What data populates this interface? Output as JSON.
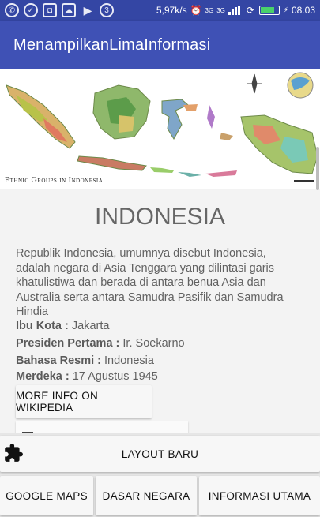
{
  "status_bar": {
    "speed": "5,97k/s",
    "net1": "3G",
    "net2": "3G",
    "time": "08.03",
    "notification_number": "3"
  },
  "app_bar": {
    "title": "MenampilkanLimaInformasi"
  },
  "map": {
    "caption": "Ethnic Groups in Indonesia"
  },
  "content": {
    "country_title": "INDONESIA",
    "description": "Republik Indonesia, umumnya disebut Indonesia, adalah negara di Asia Tenggara yang dilintasi garis khatulistiwa dan berada di antara benua Asia dan Australia serta antara Samudra Pasifik dan Samudra Hindia",
    "facts": [
      {
        "label": "Ibu Kota :",
        "value": "Jakarta"
      },
      {
        "label": "Presiden Pertama :",
        "value": "Ir. Soekarno"
      },
      {
        "label": "Bahasa Resmi :",
        "value": "Indonesia"
      },
      {
        "label": "Merdeka :",
        "value": "17 Agustus 1945"
      }
    ],
    "wiki_button": "MORE INFO ON WIKIPEDIA"
  },
  "bottom": {
    "layout_baru": "LAYOUT BARU",
    "google_maps": "GOOGLE MAPS",
    "dasar_negara": "DASAR NEGARA",
    "informasi_utama": "INFORMASI UTAMA"
  },
  "colors": {
    "status_bar": "#3446a4",
    "app_bar": "#3f51b5",
    "background": "#f3f3f3"
  }
}
